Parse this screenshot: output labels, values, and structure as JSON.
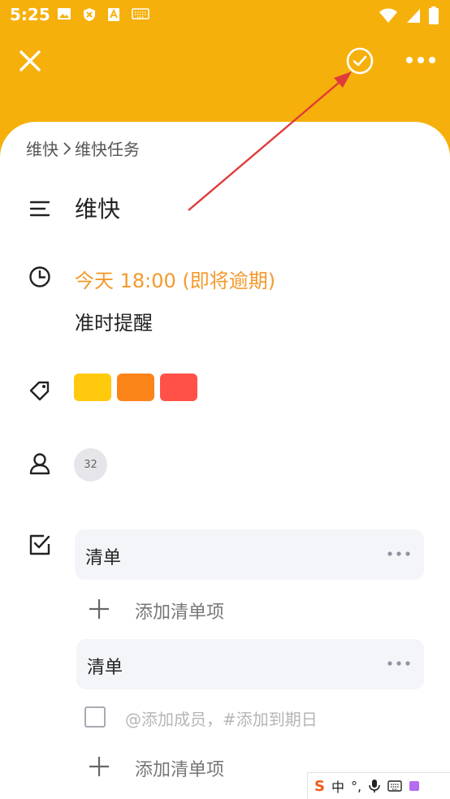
{
  "status_bar": {
    "time": "5:25",
    "icons_left": [
      "image-icon",
      "shield-icon",
      "font-icon",
      "keyboard-icon"
    ],
    "icons_right": [
      "wifi-icon",
      "signal-icon",
      "battery-icon"
    ]
  },
  "toolbar": {
    "close_icon": "close-icon",
    "done_icon": "check-circle-icon",
    "more_icon": "more-icon"
  },
  "breadcrumb": {
    "parent": "维快",
    "current": "维快任务"
  },
  "task": {
    "title": "维快",
    "due": "今天 18:00 (即将逾期)",
    "reminder": "准时提醒"
  },
  "tags": [
    {
      "color": "#ffc90e"
    },
    {
      "color": "#fb8419"
    },
    {
      "color": "#ff5147"
    }
  ],
  "assignee": {
    "avatar_text": "32"
  },
  "checklists": [
    {
      "title": "清单",
      "add_label": "添加清单项"
    },
    {
      "title": "清单",
      "item_placeholder": "@添加成员，#添加到期日",
      "add_label": "添加清单项"
    }
  ],
  "ime": {
    "logo": "S",
    "lang": "中",
    "punct": "°,"
  },
  "colors": {
    "header_bg": "#f6b00b",
    "due_orange": "#f39a2d",
    "arrow_red": "#e03b3b"
  }
}
